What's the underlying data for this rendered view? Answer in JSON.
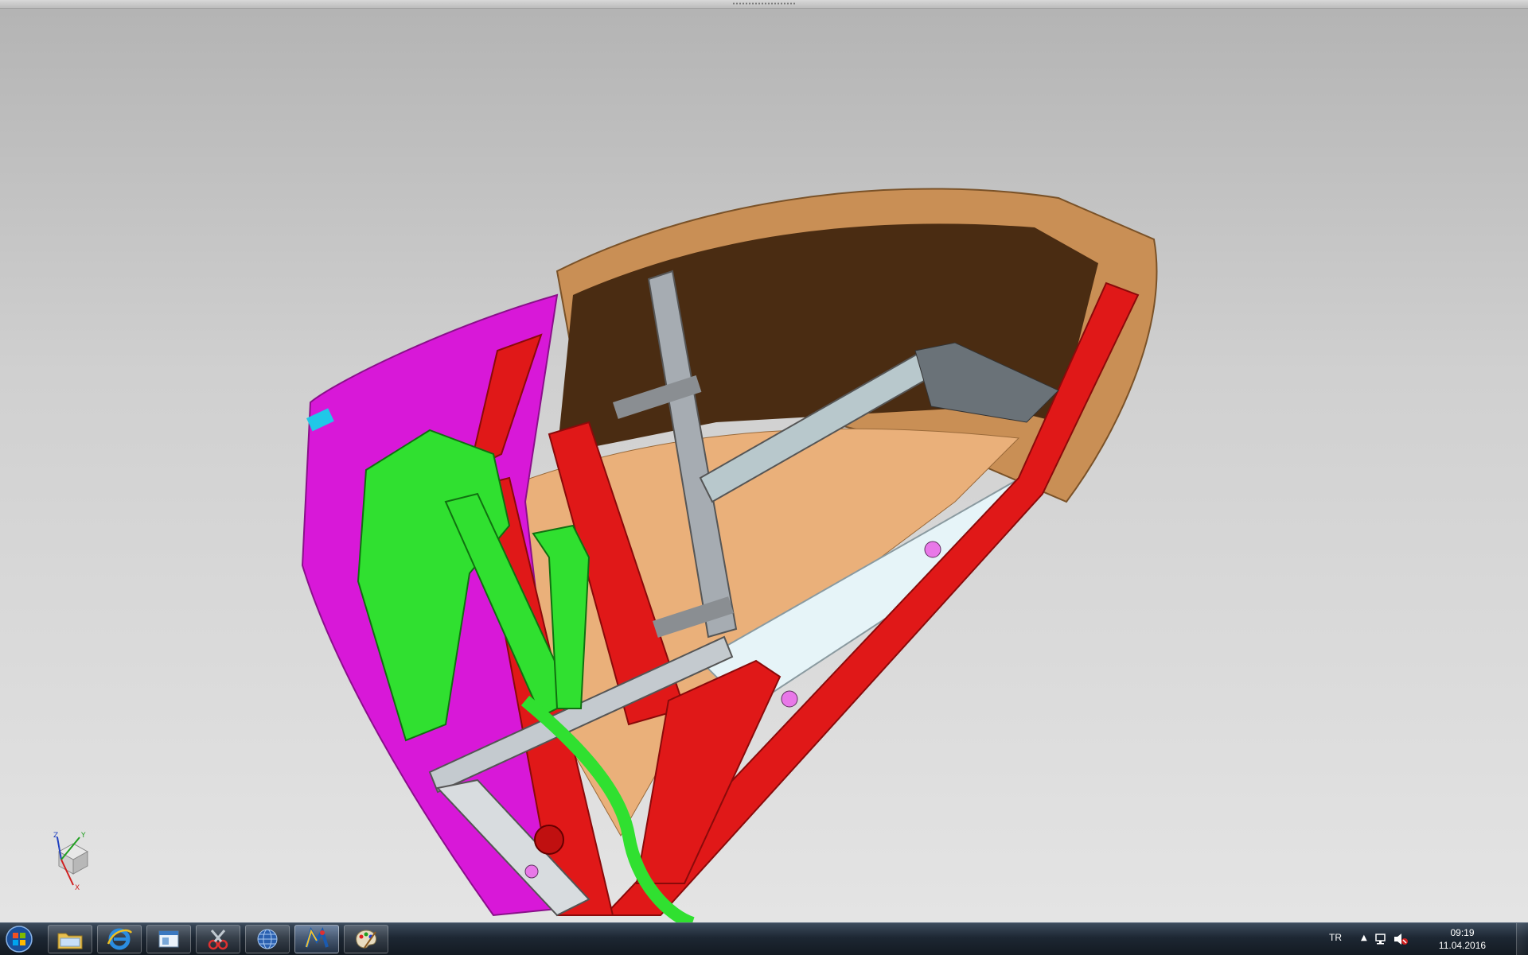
{
  "viewport": {
    "background_top": "#b4b4b4",
    "background_bottom": "#e4e4e4",
    "model_colors": {
      "shell_outer": "#c98f55",
      "shell_inner": "#4a2c12",
      "floor": "#eab07a",
      "frame": "#e01818",
      "linkage": "#30e030",
      "side_panel": "#d818d8",
      "shaft": "#a6acb2",
      "plate": "#e6f4f8"
    },
    "triad_axes": {
      "x": "X",
      "y": "Y",
      "z": "Z"
    }
  },
  "taskbar": {
    "apps": [
      {
        "name": "start-orb"
      },
      {
        "name": "explorer-icon"
      },
      {
        "name": "internet-explorer-icon"
      },
      {
        "name": "window-app-icon"
      },
      {
        "name": "snipping-tool-icon"
      },
      {
        "name": "globe-app-icon"
      },
      {
        "name": "cad-app-icon",
        "active": true
      },
      {
        "name": "paint-app-icon"
      }
    ],
    "tray": {
      "language": "TR",
      "time": "09:19",
      "date": "11.04.2016"
    }
  }
}
